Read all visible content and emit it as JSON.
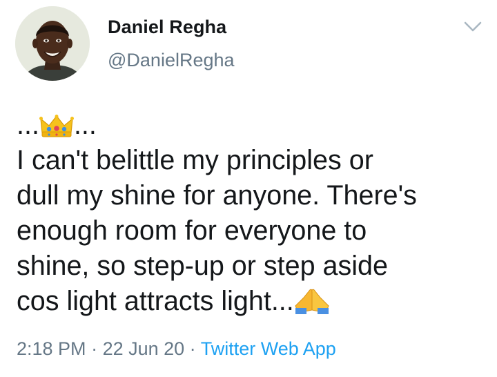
{
  "author": {
    "display_name": "Daniel Regha",
    "handle": "@DanielRegha",
    "avatar_icon": "profile-photo"
  },
  "tweet": {
    "lead_left": "...",
    "lead_emoji": "crown-emoji",
    "lead_right": "...",
    "lines": [
      "I can't belittle my principles or",
      "dull my shine for anyone. There's",
      "enough room for everyone to",
      "shine, so step-up or step aside",
      "cos light attracts light..."
    ],
    "trailing_emoji": "folded-hands-emoji"
  },
  "meta": {
    "time": "2:18 PM",
    "separator_1": " · ",
    "date": "22 Jun 20",
    "separator_2": " · ",
    "source": "Twitter Web App"
  },
  "menu_icon": "chevron-down-icon",
  "colors": {
    "text": "#14171a",
    "secondary": "#657786",
    "link": "#1da1f2",
    "background": "#ffffff"
  }
}
